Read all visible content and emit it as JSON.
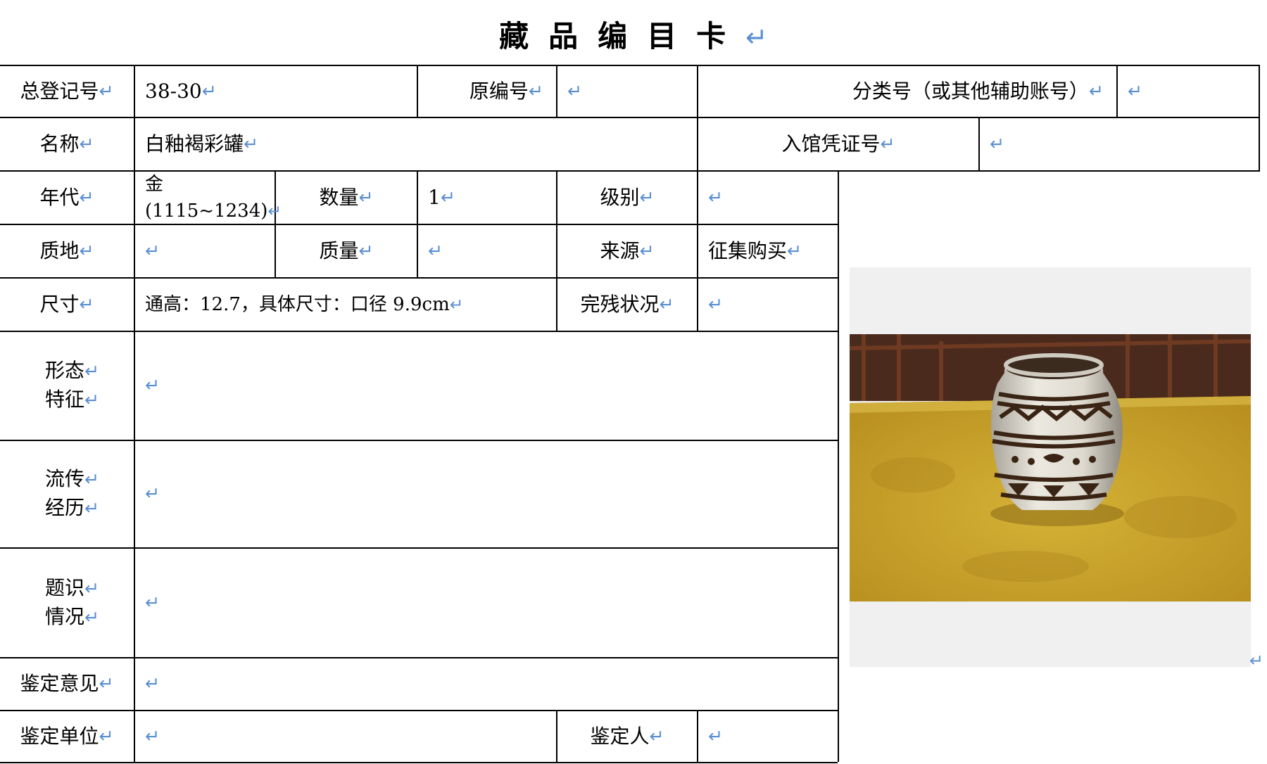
{
  "page": {
    "title": "藏品编目卡",
    "para_mark": "↵"
  },
  "card": {
    "registration_no": {
      "label": "总登记号",
      "value": "38-30"
    },
    "original_no": {
      "label": "原编号",
      "value": ""
    },
    "classification_no": {
      "label": "分类号（或其他辅助账号）",
      "value": ""
    },
    "name": {
      "label": "名称",
      "value": "白釉褐彩罐"
    },
    "entry_voucher_no": {
      "label": "入馆凭证号",
      "value": ""
    },
    "era": {
      "label": "年代",
      "value_line1": "金",
      "value_line2": "(1115~1234)"
    },
    "quantity": {
      "label": "数量",
      "value": "1"
    },
    "grade": {
      "label": "级别",
      "value": ""
    },
    "material": {
      "label": "质地",
      "value": ""
    },
    "mass": {
      "label": "质量",
      "value": ""
    },
    "source": {
      "label": "来源",
      "value": "征集购买"
    },
    "dimensions": {
      "label": "尺寸",
      "value": "通高：12.7，具体尺寸：口径 9.9cm"
    },
    "condition": {
      "label": "完残状况",
      "value": ""
    },
    "form_features": {
      "label_line1": "形态",
      "label_line2": "特征",
      "value": ""
    },
    "provenance": {
      "label_line1": "流传",
      "label_line2": "经历",
      "value": ""
    },
    "inscriptions": {
      "label_line1": "题识",
      "label_line2": "情况",
      "value": ""
    },
    "appraisal_opinion": {
      "label": "鉴定意见",
      "value": ""
    },
    "appraisal_unit": {
      "label": "鉴定单位",
      "value": ""
    },
    "appraiser": {
      "label": "鉴定人",
      "value": ""
    }
  },
  "photo": {
    "subject": "white-glazed-brown-painted-jar",
    "colors": {
      "tablecloth": "#c9a52c",
      "background": "#4a2a1c",
      "glaze": "#dcd8cc",
      "paint": "#3a2414"
    }
  }
}
